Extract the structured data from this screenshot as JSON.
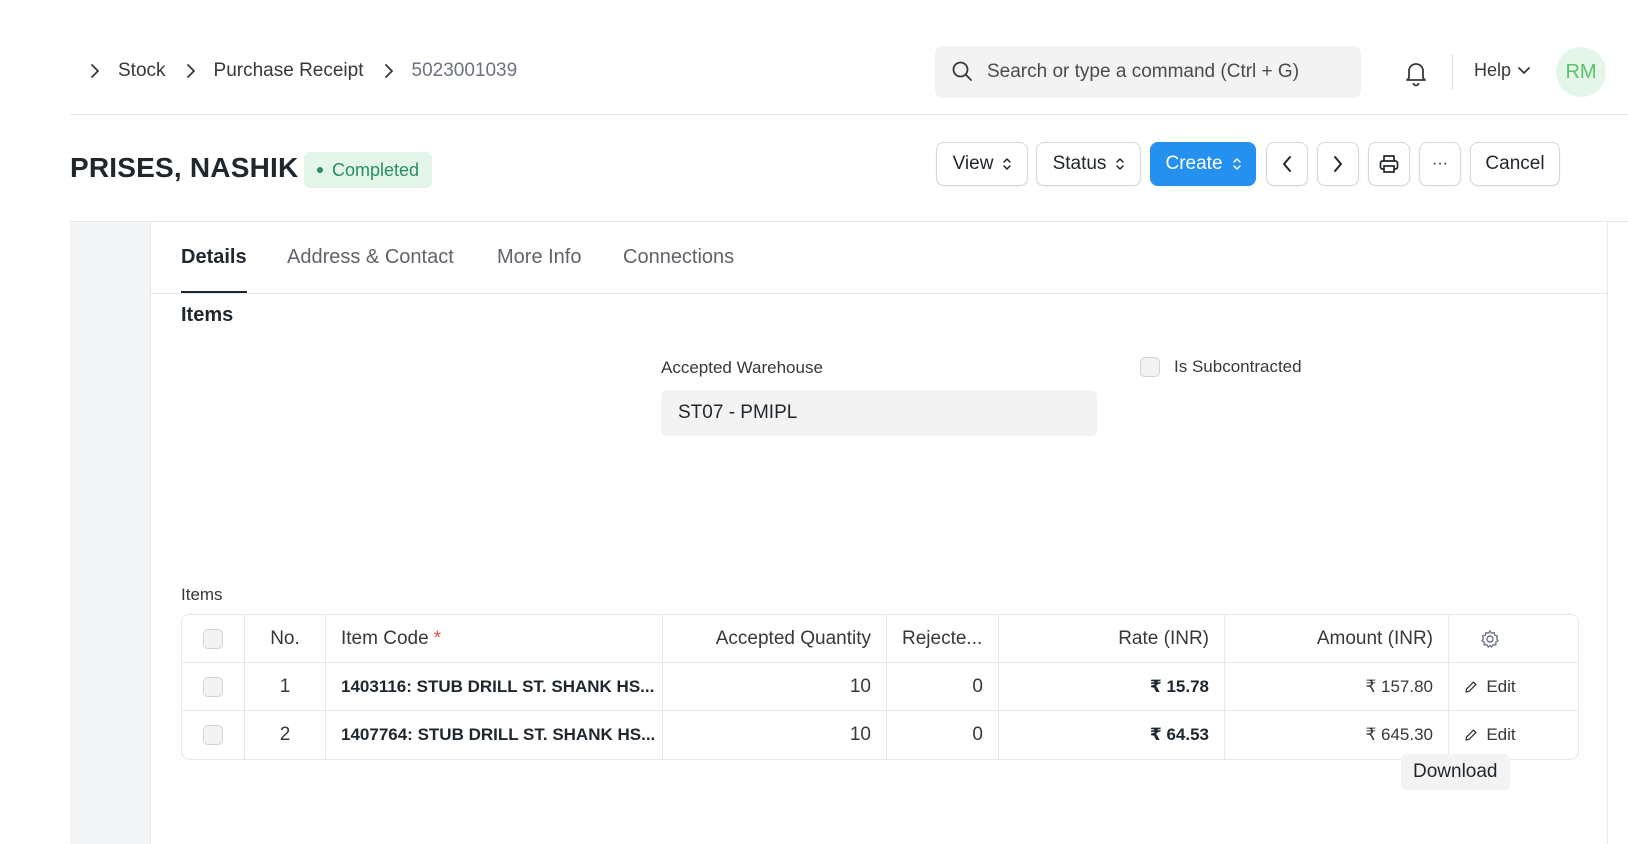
{
  "breadcrumb": [
    "Stock",
    "Purchase Receipt",
    "5023001039"
  ],
  "search": {
    "placeholder": "Search or type a command (Ctrl + G)"
  },
  "navbar": {
    "help_label": "Help",
    "avatar_initials": "RM"
  },
  "page": {
    "title": "PRISES, NASHIK",
    "status": "Completed",
    "buttons": {
      "view": "View",
      "status": "Status",
      "create": "Create",
      "cancel": "Cancel",
      "more": "···"
    }
  },
  "colors": {
    "primary": "#2490ef",
    "success_text": "#278f5e",
    "success_bg": "#e4f5e9"
  },
  "tabs": [
    {
      "label": "Details",
      "active": true
    },
    {
      "label": "Address & Contact",
      "active": false
    },
    {
      "label": "More Info",
      "active": false
    },
    {
      "label": "Connections",
      "active": false
    }
  ],
  "section": {
    "title": "Items"
  },
  "fields": {
    "accepted_warehouse": {
      "label": "Accepted Warehouse",
      "value": "ST07 - PMIPL"
    },
    "is_subcontracted": {
      "label": "Is Subcontracted",
      "checked": false
    }
  },
  "items_table": {
    "label": "Items",
    "columns": [
      "No.",
      "Item Code",
      "Accepted Quantity",
      "Rejecte...",
      "Rate (INR)",
      "Amount (INR)"
    ],
    "required_marker": "*",
    "rows": [
      {
        "no": "1",
        "item_code": "1403116: STUB DRILL ST. SHANK HS...",
        "accepted_qty": "10",
        "rejected_qty": "0",
        "rate": "₹ 15.78",
        "amount": "₹ 157.80",
        "action": "Edit"
      },
      {
        "no": "2",
        "item_code": "1407764: STUB DRILL ST. SHANK HS...",
        "accepted_qty": "10",
        "rejected_qty": "0",
        "rate": "₹ 64.53",
        "amount": "₹ 645.30",
        "action": "Edit"
      }
    ],
    "download_label": "Download"
  }
}
